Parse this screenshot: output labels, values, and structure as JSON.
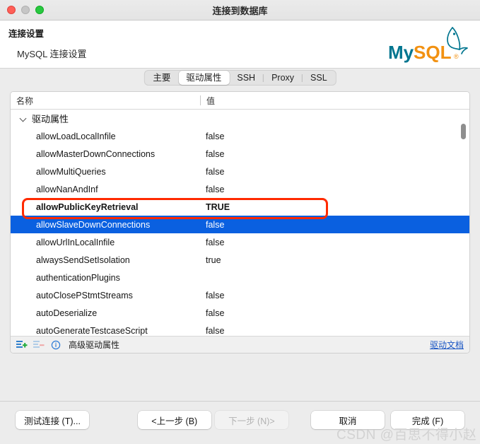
{
  "window": {
    "title": "连接到数据库",
    "traffic_lights": [
      "close",
      "minimize",
      "zoom"
    ]
  },
  "header": {
    "title": "连接设置",
    "subtitle": "MySQL 连接设置",
    "logo_text_primary": "My",
    "logo_text_secondary": "SQL",
    "logo_colors": {
      "teal": "#00758F",
      "orange": "#F29111"
    }
  },
  "tabs": [
    {
      "label": "主要",
      "active": false
    },
    {
      "label": "驱动属性",
      "active": true
    },
    {
      "label": "SSH",
      "active": false
    },
    {
      "label": "Proxy",
      "active": false
    },
    {
      "label": "SSL",
      "active": false
    }
  ],
  "table": {
    "columns": [
      "名称",
      "值"
    ],
    "group_label": "驱动属性",
    "rows": [
      {
        "name": "allowLoadLocalInfile",
        "value": "false"
      },
      {
        "name": "allowMasterDownConnections",
        "value": "false"
      },
      {
        "name": "allowMultiQueries",
        "value": "false"
      },
      {
        "name": "allowNanAndInf",
        "value": "false"
      },
      {
        "name": "allowPublicKeyRetrieval",
        "value": "TRUE"
      },
      {
        "name": "allowSlaveDownConnections",
        "value": "false"
      },
      {
        "name": "allowUrlInLocalInfile",
        "value": "false"
      },
      {
        "name": "alwaysSendSetIsolation",
        "value": "true"
      },
      {
        "name": "authenticationPlugins",
        "value": ""
      },
      {
        "name": "autoClosePStmtStreams",
        "value": "false"
      },
      {
        "name": "autoDeserialize",
        "value": "false"
      },
      {
        "name": "autoGenerateTestcaseScript",
        "value": "false"
      }
    ],
    "selected_row_index": 5,
    "highlighted_row_index": 4,
    "annotation_color": "#ff2a00"
  },
  "panel_footer": {
    "add_icon": "add-row-icon",
    "remove_icon": "remove-row-icon",
    "info_icon": "info-icon",
    "label": "高级驱动属性",
    "doc_link": "驱动文档"
  },
  "buttons": {
    "test_connection": "测试连接 (T)...",
    "previous": "<上一步 (B)",
    "next": "下一步 (N)>",
    "cancel": "取消",
    "finish": "完成 (F)"
  },
  "watermark": "CSDN @百思不得小赵"
}
